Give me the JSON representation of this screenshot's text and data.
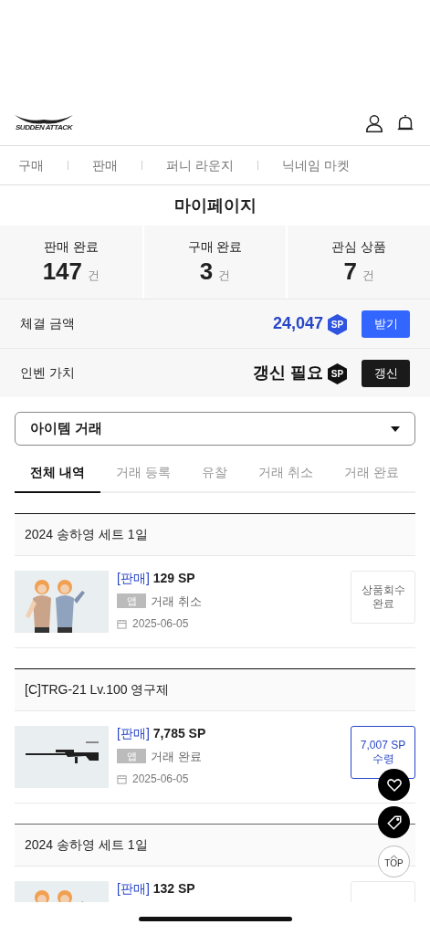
{
  "header": {
    "logo_text": "SUDDEN ATTACK"
  },
  "nav": [
    {
      "label": "구매"
    },
    {
      "label": "판매"
    },
    {
      "label": "퍼니 라운지"
    },
    {
      "label": "닉네임 마켓"
    }
  ],
  "title": "마이페이지",
  "stats": [
    {
      "label": "판매 완료",
      "value": "147",
      "unit": "건"
    },
    {
      "label": "구매 완료",
      "value": "3",
      "unit": "건"
    },
    {
      "label": "관심 상품",
      "value": "7",
      "unit": "건"
    }
  ],
  "summary_rows": [
    {
      "kind": "amount",
      "label": "체결 금액",
      "value": "24,047",
      "badge": "SP",
      "button": "받기"
    },
    {
      "kind": "pending",
      "label": "인벤 가치",
      "value": "갱신 필요",
      "badge": "SP",
      "button": "갱신"
    }
  ],
  "select": {
    "value": "아이템 거래"
  },
  "tabs": [
    {
      "label": "전체 내역",
      "selected": true
    },
    {
      "label": "거래 등록",
      "selected": false
    },
    {
      "label": "유찰",
      "selected": false
    },
    {
      "label": "거래 취소",
      "selected": false
    },
    {
      "label": "거래 완료",
      "selected": false
    }
  ],
  "items": [
    {
      "name": "2024 송하영 세트 1일",
      "type": "[판매]",
      "price": "129 SP",
      "tag": "앱",
      "status": "거래 취소",
      "date": "2025-06-05",
      "action": {
        "kind": "done",
        "label": "상품회수 완료"
      }
    },
    {
      "name": "[C]TRG-21 Lv.100 영구제",
      "type": "[판매]",
      "price": "7,785 SP",
      "tag": "앱",
      "status": "거래 완료",
      "date": "2025-06-05",
      "action": {
        "kind": "receive",
        "label": "7,007 SP 수령"
      }
    },
    {
      "name": "2024 송하영 세트 1일",
      "type": "[판매]",
      "price": "132 SP",
      "action": {
        "kind": "done"
      }
    }
  ],
  "floating": {
    "top_label": "TOP"
  }
}
